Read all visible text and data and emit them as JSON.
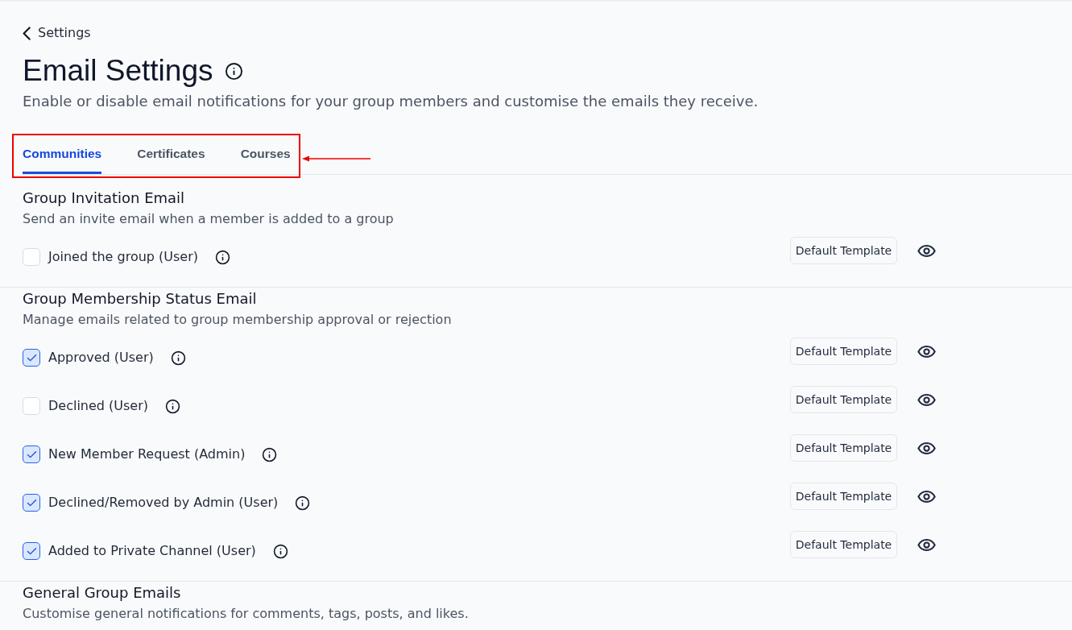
{
  "back_link": {
    "label": "Settings"
  },
  "page": {
    "title": "Email Settings",
    "subtitle": "Enable or disable email notifications for your group members and customise the emails they receive."
  },
  "tabs": {
    "highlighted": true,
    "items": [
      {
        "label": "Communities",
        "selected": true
      },
      {
        "label": "Certificates",
        "selected": false
      },
      {
        "label": "Courses",
        "selected": false
      }
    ]
  },
  "sections": [
    {
      "title": "Group Invitation Email",
      "description": "Send an invite email when a member is added to a group",
      "options": [
        {
          "label": "Joined the group (User)",
          "checked": false,
          "template_button": "Default Template"
        }
      ]
    },
    {
      "title": "Group Membership Status Email",
      "description": "Manage emails related to group membership approval or rejection",
      "options": [
        {
          "label": "Approved (User)",
          "checked": true,
          "template_button": "Default Template"
        },
        {
          "label": "Declined (User)",
          "checked": false,
          "template_button": "Default Template"
        },
        {
          "label": "New Member Request (Admin)",
          "checked": true,
          "template_button": "Default Template"
        },
        {
          "label": "Declined/Removed by Admin (User)",
          "checked": true,
          "template_button": "Default Template"
        },
        {
          "label": "Added to Private Channel (User)",
          "checked": true,
          "template_button": "Default Template"
        }
      ]
    },
    {
      "title": "General Group Emails",
      "description": "Customise general notifications for comments, tags, posts, and likes."
    }
  ]
}
